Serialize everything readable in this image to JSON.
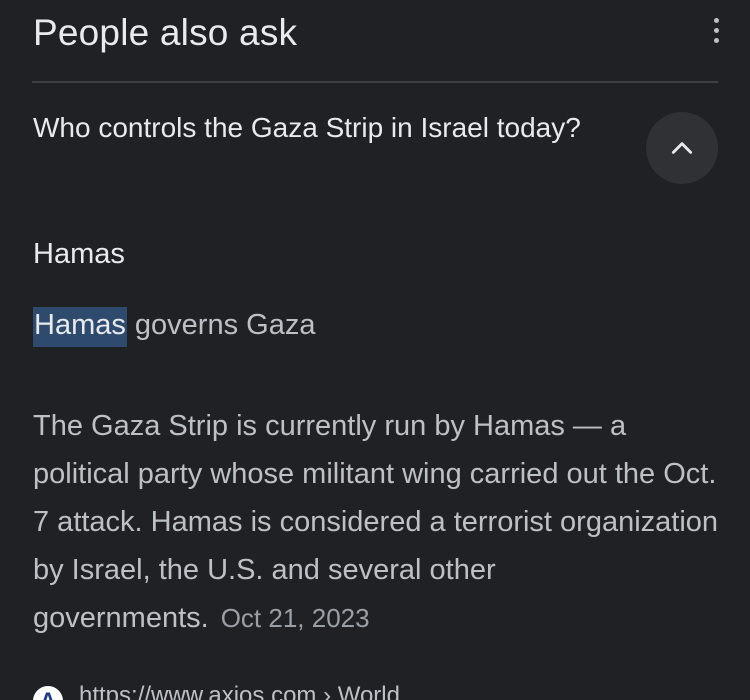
{
  "header": {
    "title": "People also ask"
  },
  "question": {
    "text": "Who controls the Gaza Strip in Israel today?"
  },
  "answer": {
    "title": "Hamas",
    "highlight": "Hamas",
    "subtitle_rest": " governs Gaza",
    "snippet": "The Gaza Strip is currently run by Hamas — a political party whose militant wing carried out the Oct. 7 attack. Hamas is considered a terrorist organization by Israel, the U.S. and several other governments.",
    "date": "Oct 21, 2023"
  },
  "source": {
    "favicon_letter": "A",
    "url": "https://www.axios.com › World"
  },
  "icons": {
    "more": "more-vert-icon",
    "collapse": "chevron-up-icon"
  },
  "colors": {
    "background": "#202124",
    "highlight": "#2e4b6e",
    "button": "#303134"
  }
}
